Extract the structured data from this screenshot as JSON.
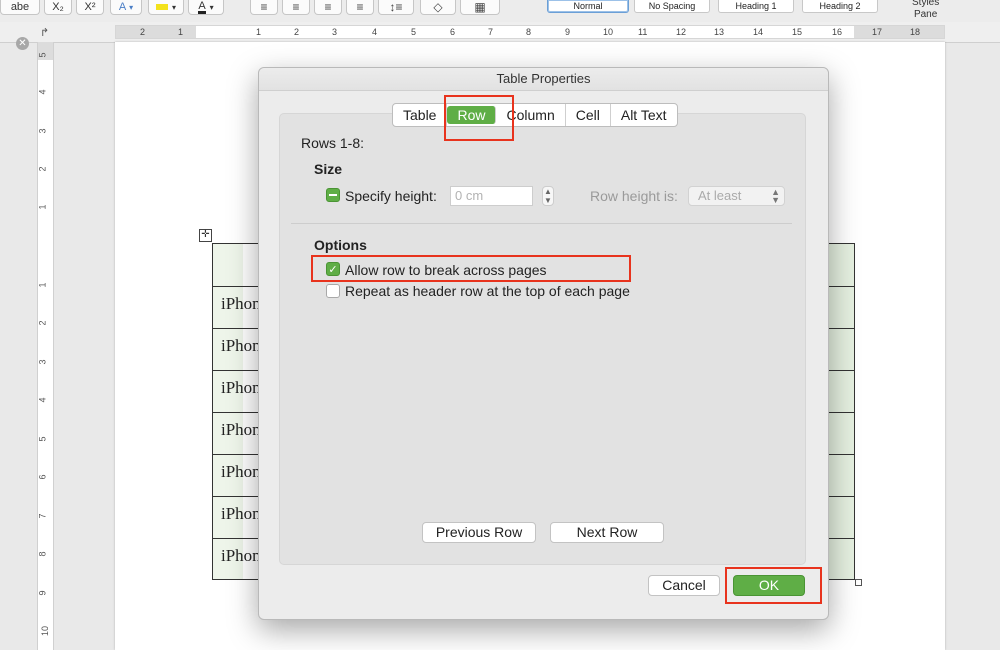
{
  "toolbar": {
    "strikethrough": "abe",
    "subscript": "X₂",
    "superscript": "X²",
    "text_effects": "A",
    "highlight": "ab",
    "font_color": "A"
  },
  "styles": {
    "items": [
      {
        "label": "Normal",
        "selected": true
      },
      {
        "label": "No Spacing",
        "selected": false
      },
      {
        "label": "Heading 1",
        "selected": false
      },
      {
        "label": "Heading 2",
        "selected": false
      }
    ],
    "pane_label_line1": "Styles",
    "pane_label_line2": "Pane"
  },
  "ruler": {
    "h_numbers": [
      "2",
      "1",
      "1",
      "2",
      "3",
      "4",
      "5",
      "6",
      "7",
      "8",
      "9",
      "10",
      "11",
      "12",
      "13",
      "14",
      "15",
      "16",
      "17",
      "18"
    ],
    "v_numbers": [
      "5",
      "4",
      "3",
      "2",
      "1",
      "1",
      "2",
      "3",
      "4",
      "5",
      "6",
      "7",
      "8",
      "9",
      "10"
    ]
  },
  "document": {
    "cells": [
      "iPhon",
      "iPhon",
      "iPhon",
      "iPhon",
      "iPhon",
      "iPhon",
      "iPhon"
    ]
  },
  "dialog": {
    "title": "Table Properties",
    "tabs": [
      {
        "label": "Table",
        "active": false
      },
      {
        "label": "Row",
        "active": true
      },
      {
        "label": "Column",
        "active": false
      },
      {
        "label": "Cell",
        "active": false
      },
      {
        "label": "Alt Text",
        "active": false
      }
    ],
    "rows_label": "Rows 1-8:",
    "size": {
      "heading": "Size",
      "specify_height_label": "Specify height:",
      "height_value": "0 cm",
      "row_height_is_label": "Row height is:",
      "row_height_is_value": "At least"
    },
    "options": {
      "heading": "Options",
      "allow_break_label": "Allow row to break across pages",
      "allow_break_checked": true,
      "repeat_header_label": "Repeat as header row at the top of each page",
      "repeat_header_checked": false
    },
    "previous_row": "Previous Row",
    "next_row": "Next Row",
    "cancel": "Cancel",
    "ok": "OK"
  },
  "colors": {
    "accent_green": "#5fae46",
    "highlight_red": "#e8331d"
  }
}
